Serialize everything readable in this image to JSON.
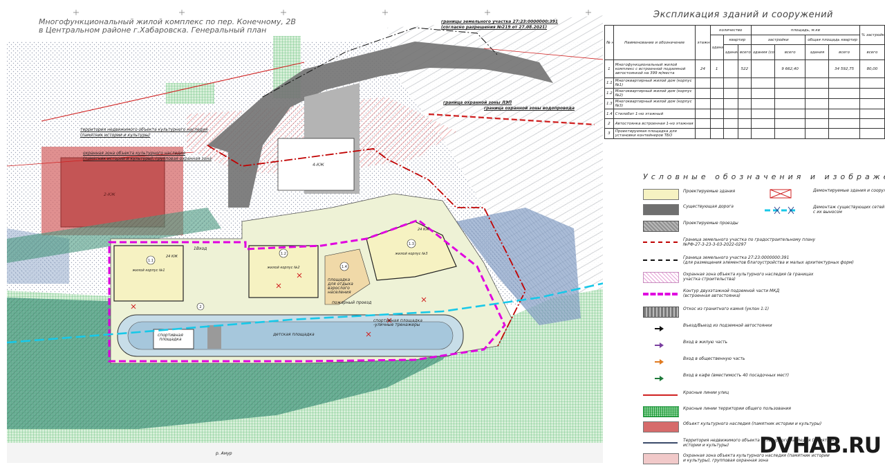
{
  "title": {
    "line1": "Многофункциональный жилой комплекс по пер. Конечному, 2В",
    "line2": "в Центральном районе г.Хабаровска. Генеральный план"
  },
  "map_labels": {
    "land_boundary_line1": "границы земельного участка 27:23:0000000:391",
    "land_boundary_line2": "(согласно разрешения №219 от 27.08.2021)",
    "heritage_territory_line1": "территория недвижимого объекта культурного наследия",
    "heritage_territory_line2": "(памятник истории и культуры)",
    "heritage_zone_line1": "охранная зона объекта культурного наследия",
    "heritage_zone_line2": "(памятник истории и культуры), групповая охранная зона",
    "power_zone": "граница охранной зоны ЛЭП",
    "water_zone": "граница охранной зоны водопровода",
    "building1_name": "жилой корпус №1",
    "building2_name": "жилой корпус №2",
    "building3_name": "жилой корпус №3",
    "playground_label_line1": "площадка",
    "playground_label_line2": "для отдыха",
    "playground_label_line3": "взрослого",
    "playground_label_line4": "населения",
    "fire_passage": "пожарный проезд",
    "sports_ground_line1": "спортивная",
    "sports_ground_line2": "площадка",
    "kids_ground": "детская площадка",
    "sport_area_line1": "спортивная площадка",
    "sport_area_line2": "-уличные тренажеры",
    "river": "р. Амур",
    "floors_24": "24 КЖ",
    "circle_11": "1.1",
    "circle_12": "1.2",
    "circle_13": "1.3",
    "circle_14": "1.4",
    "circle_2": "2",
    "existing_building": "4-КЖ",
    "heritage_building": "2-КЖ",
    "gate": "1Вход"
  },
  "explication": {
    "title": "Экспликация зданий и сооружений",
    "headers": {
      "no": "№ на плане",
      "name": "Наименование и обозначение",
      "floors": "этажность",
      "quantity": "количество",
      "buildings": "зданий (сооружений)",
      "apartments": "квартир",
      "per_building": "здания",
      "total": "всего",
      "area": "площадь, м.кв",
      "built": "застройки",
      "built_building": "здания (сооружения)",
      "built_total": "всего",
      "total_area": "общая площадь квартир",
      "ta_building": "здания",
      "ta_total": "всего",
      "percent": "% застройки",
      "all": "всего"
    },
    "rows": [
      {
        "no": "1",
        "name": "Многофункциональный жилой комплекс с встроенной подземной автостоянкой на 399 м/места",
        "floors": "24",
        "buildings": "1",
        "apt_building": "",
        "apt_total": "522",
        "built_building": "",
        "built_total": "9 662,40",
        "ta_building": "",
        "ta_total": "34 592,75",
        "percent": "80,00"
      },
      {
        "no": "1.1",
        "name": "Многоквартирный жилой дом (корпус №1)",
        "floors": "",
        "buildings": "",
        "apt_building": "",
        "apt_total": "",
        "built_building": "",
        "built_total": "",
        "ta_building": "",
        "ta_total": "",
        "percent": ""
      },
      {
        "no": "1.2",
        "name": "Многоквартирный жилой дом (корпус №2)",
        "floors": "",
        "buildings": "",
        "apt_building": "",
        "apt_total": "",
        "built_building": "",
        "built_total": "",
        "ta_building": "",
        "ta_total": "",
        "percent": ""
      },
      {
        "no": "1.3",
        "name": "Многоквартирный жилой дом (корпус №3)",
        "floors": "",
        "buildings": "",
        "apt_building": "",
        "apt_total": "",
        "built_building": "",
        "built_total": "",
        "ta_building": "",
        "ta_total": "",
        "percent": ""
      },
      {
        "no": "1.4",
        "name": "Стилобат 1-но этажный",
        "floors": "",
        "buildings": "",
        "apt_building": "",
        "apt_total": "",
        "built_building": "",
        "built_total": "",
        "ta_building": "",
        "ta_total": "",
        "percent": ""
      },
      {
        "no": "2",
        "name": "Автостоянка встроенная 1-но этажная",
        "floors": "",
        "buildings": "",
        "apt_building": "",
        "apt_total": "",
        "built_building": "",
        "built_total": "",
        "ta_building": "",
        "ta_total": "",
        "percent": ""
      },
      {
        "no": "3",
        "name": "Проектируемая площадка для установки контейнеров ТБО",
        "floors": "",
        "buildings": "",
        "apt_building": "",
        "apt_total": "",
        "built_building": "",
        "built_total": "",
        "ta_building": "",
        "ta_total": "",
        "percent": ""
      }
    ]
  },
  "legend": {
    "title": "Условные обозначения и изображения",
    "items": [
      {
        "label": "Проектируемые здания",
        "icon": "yellow-fill-swatch",
        "color": "#f6f2c2"
      },
      {
        "label": "Существующая дорога",
        "icon": "dark-grey-swatch",
        "color": "#6f6f6f"
      },
      {
        "label": "Проектируемые проезды",
        "icon": "grey-hatched-swatch",
        "color": "#a9a9a9"
      },
      {
        "label": "Граница земельного участка по градостроительному плану",
        "label2": "№РФ-27-3-23-3-03-2022-0297",
        "icon": "red-dashdot-line",
        "color": "#c00000"
      },
      {
        "label": "Граница земельного участка 27:23:0000000:391",
        "label2": "(для размещения элементов благоустройства и малых архитектурных форм)",
        "icon": "black-dashdot-line",
        "color": "#111111"
      },
      {
        "label": "Охранная зона объекта культурного наследия (в границах",
        "label2": "участка строительства)",
        "icon": "pink-hatch-swatch",
        "color": "#e7a3d8"
      },
      {
        "label": "Контур двухэтажной подземной части МКД",
        "label2": "(встроенная автостоянка)",
        "icon": "magenta-dash-line",
        "color": "#e000e0"
      },
      {
        "label": "Откос из гранитного камня (уклон 1:1)",
        "icon": "stone-slope-swatch",
        "color": "#8a8a8a"
      },
      {
        "label": "Въезд/Выезд из подземной автостоянки",
        "icon": "double-arrow-icon",
        "color": "#111111"
      },
      {
        "label": "Вход в жилую часть",
        "icon": "arrow-purple-icon",
        "color": "#7a3fa0"
      },
      {
        "label": "Вход в общественную часть",
        "icon": "arrow-orange-icon",
        "color": "#e07a20"
      },
      {
        "label": "Вход в кафе (вместимость 40 посадочных мест)",
        "icon": "arrow-green-icon",
        "color": "#1e7a3a"
      },
      {
        "label": "Красные линии улиц",
        "icon": "red-line",
        "color": "#d02020"
      },
      {
        "label": "Красные линии территории общего пользования",
        "icon": "green-grid-swatch",
        "color": "#3db85a"
      },
      {
        "label": "Объект культурного наследия (памятник истории и культуры)",
        "icon": "red-fill-swatch",
        "color": "#d66b6b"
      },
      {
        "label": "Территория недвижимого объекта культурного наследия (памятник",
        "label2": "истории и культуры)",
        "icon": "blue-grey-line",
        "color": "#3a4a6a"
      },
      {
        "label": "Охранная зона объекта культурного наследия (памятник истории",
        "label2": "и культуры), групповая охранная зона",
        "icon": "pink-fill-swatch",
        "color": "#f1c9c9"
      }
    ],
    "right_items": [
      {
        "label": "Демонтируемые здания и сооружения",
        "icon": "cross-rect-icon",
        "color": "#d02020"
      },
      {
        "label": "Демонтаж существующих сетей",
        "label2": "с их выносом",
        "icon": "cyan-dash-line",
        "color": "#18c8e8"
      }
    ]
  },
  "watermark": "DVHAB.RU"
}
